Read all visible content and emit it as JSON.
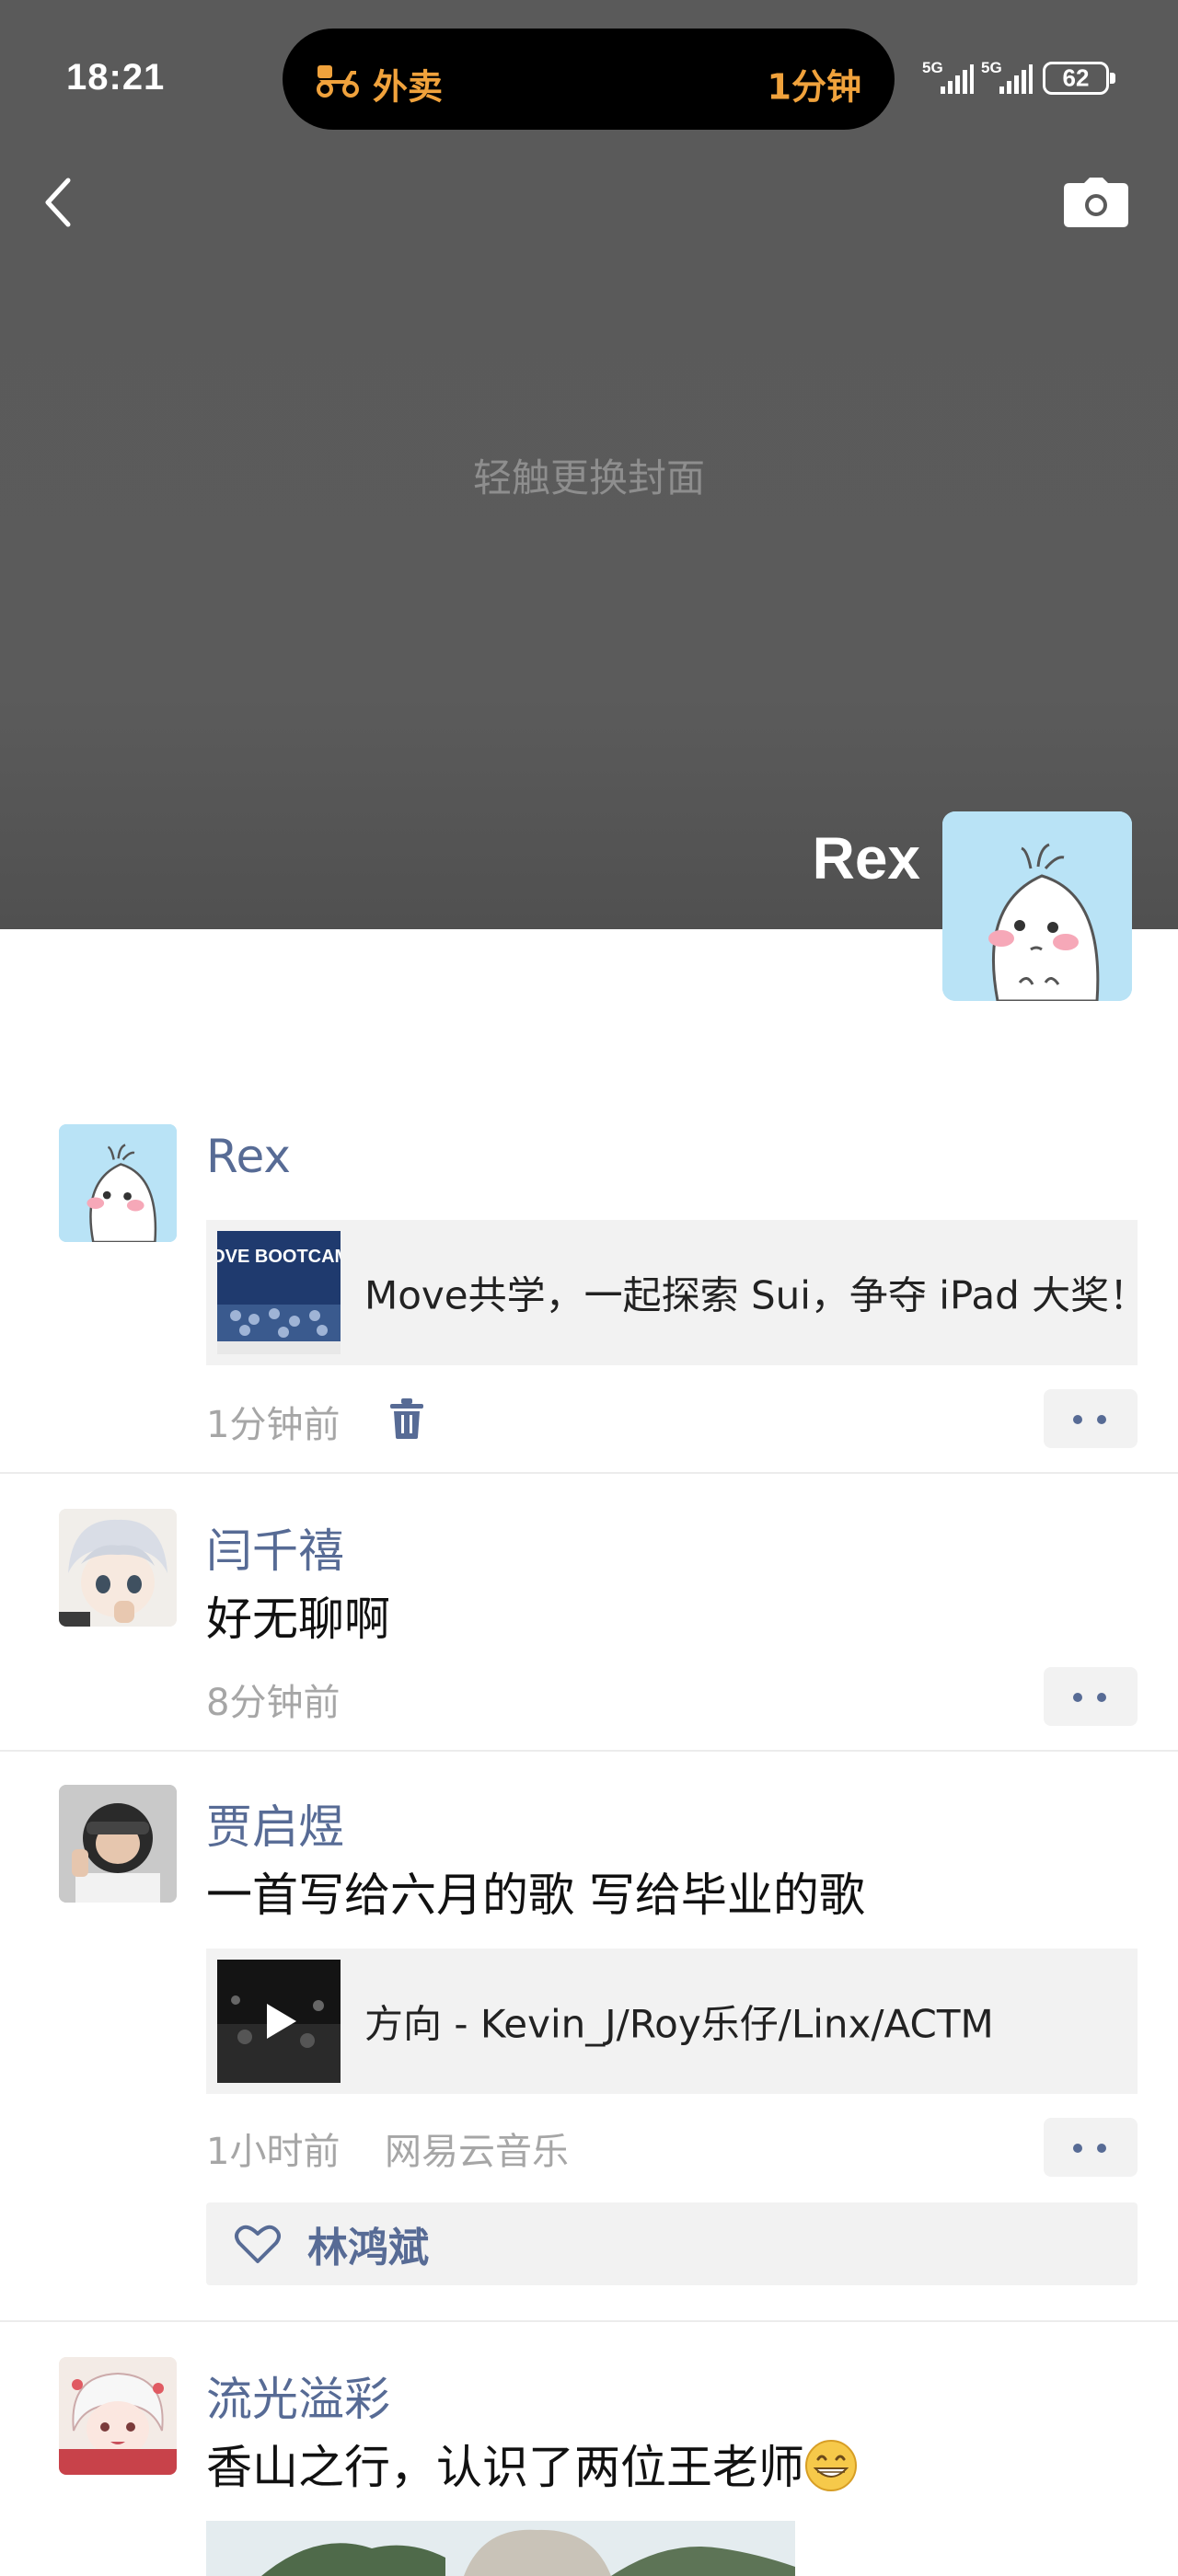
{
  "status_bar": {
    "time": "18:21",
    "island_app": "外卖",
    "island_eta": "1分钟",
    "network1": "5G",
    "network2": "5G",
    "battery": "62"
  },
  "cover": {
    "hint": "轻触更换封面",
    "profile_name": "Rex"
  },
  "posts": [
    {
      "name": "Rex",
      "share": {
        "title": "Move共学，一起探索 Sui，争夺 iPad 大奖！",
        "thumb_text": "MOVE BOOTCAMP"
      },
      "time": "1分钟前"
    },
    {
      "name": "闫千禧",
      "text": "好无聊啊",
      "time": "8分钟前"
    },
    {
      "name": "贾启煜",
      "text": "一首写给六月的歌 写给毕业的歌",
      "share": {
        "title": "方向 - Kevin_J/Roy乐仔/Linx/ACTM"
      },
      "time": "1小时前",
      "source": "网易云音乐",
      "likes": [
        "林鸿斌"
      ]
    },
    {
      "name": "流光溢彩",
      "text": "香山之行，认识了两位王老师"
    }
  ],
  "colors": {
    "link_blue": "#576b95",
    "island_orange": "#f0a23c"
  }
}
